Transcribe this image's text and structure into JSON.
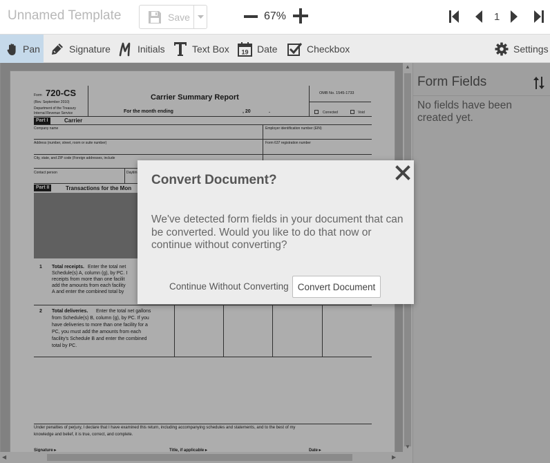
{
  "app": {
    "title": "Unnamed Template",
    "save_label": "Save",
    "zoom": "67%",
    "page_number": "1"
  },
  "tools": [
    {
      "label": "Pan",
      "icon": "hand-icon"
    },
    {
      "label": "Signature",
      "icon": "pen-icon"
    },
    {
      "label": "Initials",
      "icon": "initials-icon"
    },
    {
      "label": "Text Box",
      "icon": "text-icon"
    },
    {
      "label": "Date",
      "icon": "calendar-icon"
    },
    {
      "label": "Checkbox",
      "icon": "checkbox-icon"
    },
    {
      "label": "Settings",
      "icon": "gear-icon"
    }
  ],
  "calendar_day": "19",
  "panel": {
    "title": "Form Fields",
    "empty_message": "No fields have been created yet."
  },
  "modal": {
    "title": "Convert Document?",
    "message": "We've detected form fields in your document that can be converted. Would you like to do that now or continue without converting?",
    "secondary_button": "Continue Without Converting",
    "primary_button": "Convert Document"
  },
  "document": {
    "form_prefix": "Form",
    "form_number": "720-CS",
    "rev": "(Rev. September 2010)",
    "dept": "Department of the Treasury",
    "irs": "Internal Revenue Service",
    "title": "Carrier Summary Report",
    "for_month": "For the month ending",
    "year_prefix": ", 20",
    "year_dot": ".",
    "omb": "OMB No. 1545-1733",
    "corrected": "Corrected",
    "void": "Void",
    "part1_tag": "Part I",
    "part1_title": "Carrier",
    "company_name": "Company name",
    "ein": "Employer identification number (EIN)",
    "address": "Address (number, street, room or suite number)",
    "form637": "Form 637 registration number",
    "city": "City, state, and ZIP code (Foreign addresses, include",
    "contact": "Contact person",
    "daytime": "Daytim",
    "part2_tag": "Part II",
    "part2_title": "Transactions for the Mon",
    "line1_num": "1",
    "line1_title": "Total receipts.",
    "line1_a": "Enter the total net",
    "line1_b": "Schedule(s) A, column (g), by PC. I",
    "line1_c": "receipts from more than one facilit",
    "line1_d": "add the amounts from each facility",
    "line1_e": "A and enter the combined total by",
    "line2_num": "2",
    "line2_title": "Total deliveries.",
    "line2_a": "Enter the total net gallons",
    "line2_b": "from Schedule(s) B, column (g), by PC. If you",
    "line2_c": "have deliveries to more than one facility for a",
    "line2_d": "PC, you must add the amounts from each",
    "line2_e": "facility's Schedule B and enter the combined",
    "line2_f": "total by PC.",
    "perjury_a": "Under penalties of perjury, I declare that I have examined this return, including accompanying schedules and statements, and to the best of my",
    "perjury_b": "knowledge and belief, it is true, correct, and complete.",
    "sig_label": "Signature ▸",
    "title_label": "Title, if applicable ▸",
    "date_label": "Date ▸"
  },
  "colors": {
    "active_tool_bg": "#c5d9ea",
    "modal_bg": "#ececec",
    "panel_bg": "#e4e4e4"
  }
}
